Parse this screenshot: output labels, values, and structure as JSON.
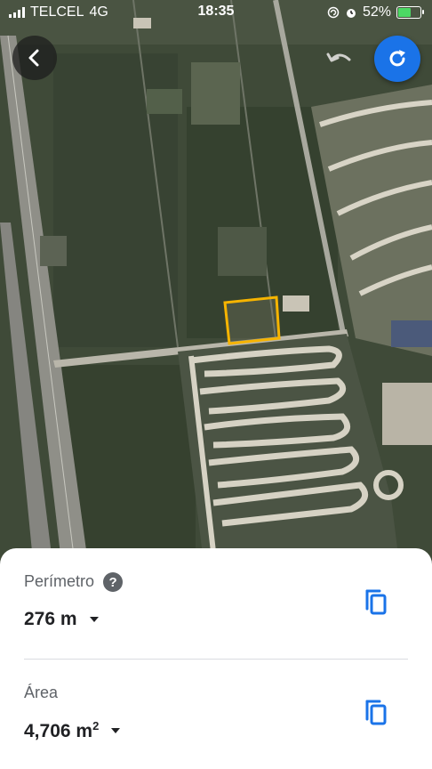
{
  "status_bar": {
    "carrier": "TELCEL",
    "network": "4G",
    "time": "18:35",
    "battery_percent": "52%",
    "battery_level": 0.52
  },
  "map": {
    "type": "satellite",
    "colors": {
      "vegetation": "#3f4a38",
      "road": "#9a9a94",
      "clearing": "#c9c4b6",
      "parcel_outline": "#f6b400"
    }
  },
  "controls": {
    "back_icon": "chevron-left-icon",
    "undo_icon": "undo-icon",
    "refresh_icon": "refresh-icon",
    "accent": "#1a73e8"
  },
  "measure": {
    "perimeter": {
      "label": "Perímetro",
      "value": "276 m"
    },
    "area": {
      "label": "Área",
      "value": "4,706 m",
      "unit_superscript": "2"
    }
  }
}
